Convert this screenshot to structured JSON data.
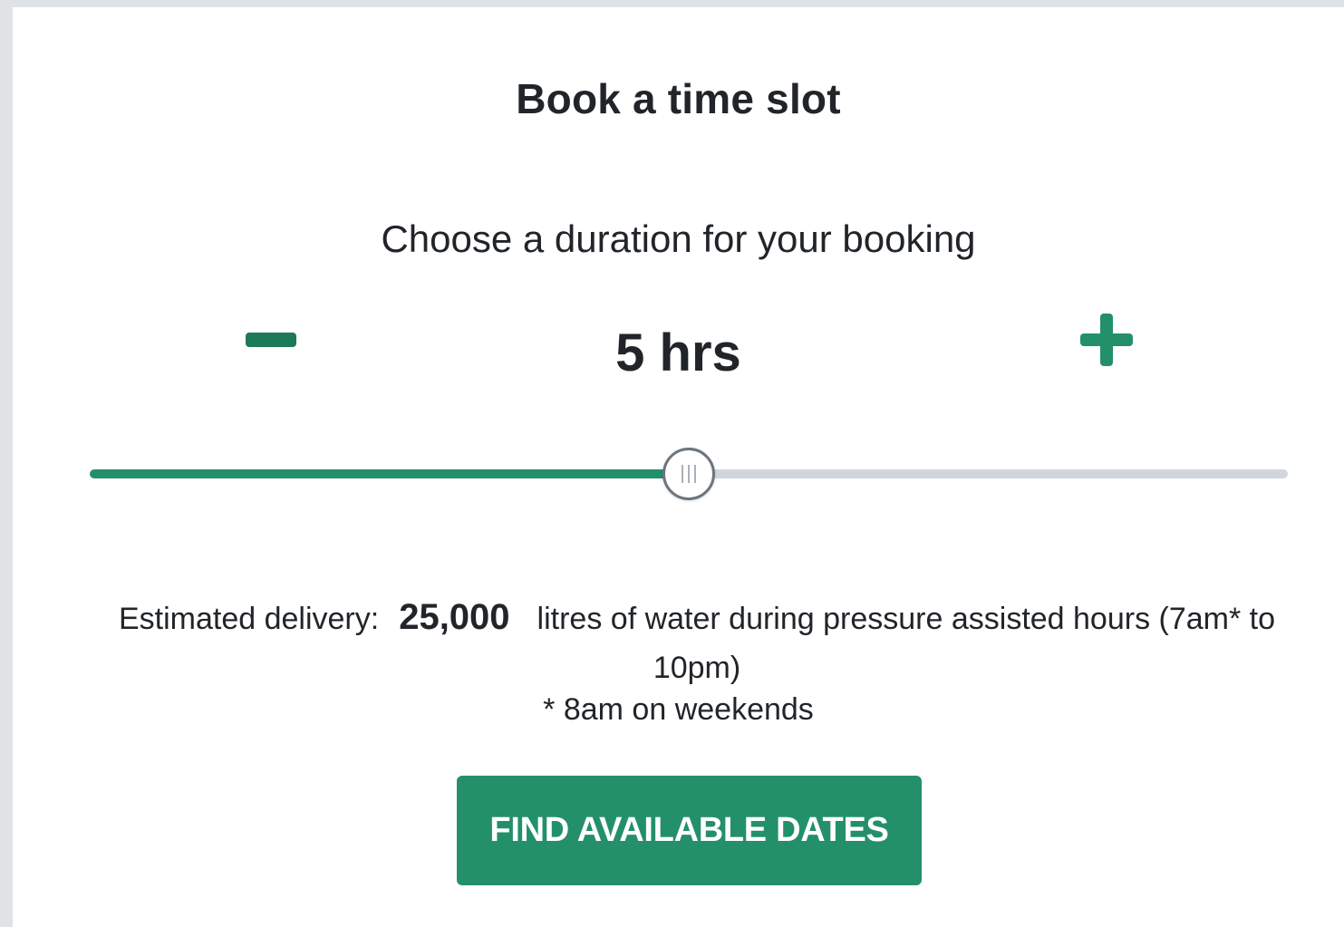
{
  "header": {
    "title": "Book a time slot"
  },
  "duration": {
    "prompt": "Choose a duration for your booking",
    "value_label": "5 hrs",
    "decrement_icon": "minus-icon",
    "increment_icon": "plus-icon",
    "slider_fraction": 0.5
  },
  "delivery": {
    "prefix": "Estimated delivery:",
    "amount": "25,000",
    "suffix": "litres of water during pressure assisted hours (7am* to 10pm)",
    "footnote": "* 8am on weekends"
  },
  "actions": {
    "find_dates_label": "FIND AVAILABLE DATES"
  },
  "colors": {
    "accent": "#23906a",
    "track": "#d1d6dc",
    "page_background": "#dfe3e6",
    "card_background": "#ffffff"
  }
}
